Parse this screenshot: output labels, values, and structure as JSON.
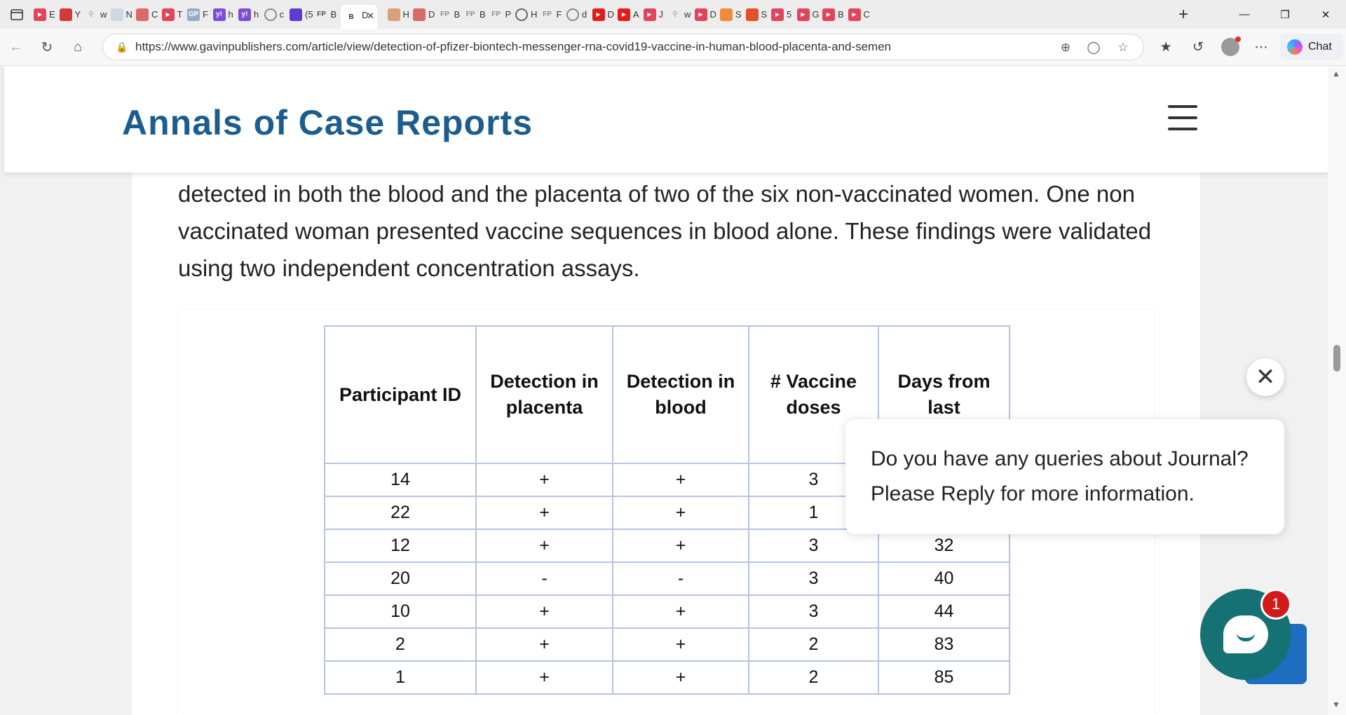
{
  "browser": {
    "tabs": [
      {
        "title": "E",
        "icon": "youtube",
        "color": "#e0455b"
      },
      {
        "title": "Y",
        "icon": "edge-figure",
        "color": "#d23a3a"
      },
      {
        "title": "w",
        "icon": "search",
        "color": "#8a9bb5"
      },
      {
        "title": "N",
        "icon": "blank",
        "color": "#cfd6e4"
      },
      {
        "title": "C",
        "icon": "arrow",
        "color": "#d86a6a"
      },
      {
        "title": "T",
        "icon": "youtube",
        "color": "#e0455b"
      },
      {
        "title": "F",
        "icon": "gp",
        "color": "#9aa9c6"
      },
      {
        "title": "h",
        "icon": "yahoo",
        "color": "#7a4fd3"
      },
      {
        "title": "h",
        "icon": "yahoo",
        "color": "#7a4fd3"
      },
      {
        "title": "c",
        "icon": "lock",
        "color": "#8a8a8a"
      },
      {
        "title": "(5",
        "icon": "mail",
        "color": "#5d3bd0"
      },
      {
        "title": "B",
        "icon": "fp",
        "color": "#555555"
      },
      {
        "title": "D",
        "icon": "active",
        "color": "#ffffff"
      },
      {
        "title": "H",
        "icon": "image",
        "color": "#d9a17b"
      },
      {
        "title": "D",
        "icon": "arrow",
        "color": "#d86a6a"
      },
      {
        "title": "B",
        "icon": "fp",
        "color": "#8c8c8c"
      },
      {
        "title": "B",
        "icon": "fp",
        "color": "#8c8c8c"
      },
      {
        "title": "P",
        "icon": "fp",
        "color": "#8c8c8c"
      },
      {
        "title": "H",
        "icon": "circle",
        "color": "#666666"
      },
      {
        "title": "F",
        "icon": "fp",
        "color": "#8c8c8c"
      },
      {
        "title": "d",
        "icon": "lock",
        "color": "#8a8a8a"
      },
      {
        "title": "D",
        "icon": "youtube-red",
        "color": "#e31b1b"
      },
      {
        "title": "A",
        "icon": "youtube-red",
        "color": "#e31b1b"
      },
      {
        "title": "J",
        "icon": "youtube",
        "color": "#e0455b"
      },
      {
        "title": "w",
        "icon": "search",
        "color": "#8a9bb5"
      },
      {
        "title": "D",
        "icon": "youtube",
        "color": "#e0455b"
      },
      {
        "title": "S",
        "icon": "ai",
        "color": "#f08a3e"
      },
      {
        "title": "S",
        "icon": "ai-red",
        "color": "#e2502a"
      },
      {
        "title": "5",
        "icon": "youtube",
        "color": "#e0455b"
      },
      {
        "title": "G",
        "icon": "youtube",
        "color": "#e0455b"
      },
      {
        "title": "B",
        "icon": "youtube",
        "color": "#e0455b"
      },
      {
        "title": "C",
        "icon": "youtube",
        "color": "#e0455b"
      }
    ],
    "url": "https://www.gavinpublishers.com/article/view/detection-of-pfizer-biontech-messenger-rna-covid19-vaccine-in-human-blood-placenta-and-semen",
    "chat_label": "Chat"
  },
  "site": {
    "title": "Annals of Case Reports",
    "paragraph": "detected in both the blood and the placenta of two of the six non-vaccinated women. One non vaccinated woman presented vaccine sequences in blood alone. These findings were validated using two independent concentration assays."
  },
  "table": {
    "headers": [
      "Participant ID",
      "Detection in placenta",
      "Detection in blood",
      "# Vaccine doses",
      "Days from last"
    ],
    "rows": [
      [
        "14",
        "+",
        "+",
        "3",
        ""
      ],
      [
        "22",
        "+",
        "+",
        "1",
        ""
      ],
      [
        "12",
        "+",
        "+",
        "3",
        "32"
      ],
      [
        "20",
        "-",
        "-",
        "3",
        "40"
      ],
      [
        "10",
        "+",
        "+",
        "3",
        "44"
      ],
      [
        "2",
        "+",
        "+",
        "2",
        "83"
      ],
      [
        "1",
        "+",
        "+",
        "2",
        "85"
      ]
    ]
  },
  "popup": {
    "line1": "Do you have any queries about Journal?",
    "line2": "Please Reply for more information.",
    "close": "✕",
    "badge": "1"
  },
  "colors": {
    "brand": "#1c5d8e",
    "table_border": "#b6c4df",
    "chat_teal": "#157173",
    "badge_red": "#d31a1a"
  }
}
